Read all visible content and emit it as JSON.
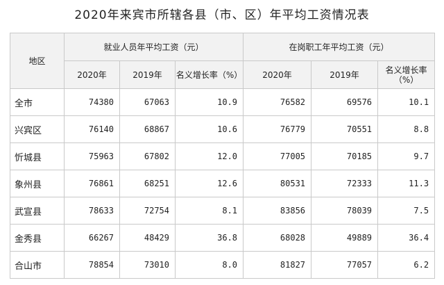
{
  "title": "2020年来宾市所辖各县（市、区）年平均工资情况表",
  "header": {
    "region": "地区",
    "group1": "就业人员年平均工资（元）",
    "group2": "在岗职工年平均工资（元）",
    "col_2020": "2020年",
    "col_2019": "2019年",
    "col_growth": "名义增长率（%）",
    "col_growth2": "名义增长率（%）"
  },
  "rows": [
    {
      "region": "全市",
      "e2020": "74380",
      "e2019": "67063",
      "eg": "10.9",
      "s2020": "76582",
      "s2019": "69576",
      "sg": "10.1"
    },
    {
      "region": "兴宾区",
      "e2020": "76140",
      "e2019": "68867",
      "eg": "10.6",
      "s2020": "76779",
      "s2019": "70551",
      "sg": "8.8"
    },
    {
      "region": "忻城县",
      "e2020": "75963",
      "e2019": "67802",
      "eg": "12.0",
      "s2020": "77005",
      "s2019": "70185",
      "sg": "9.7"
    },
    {
      "region": "象州县",
      "e2020": "76861",
      "e2019": "68251",
      "eg": "12.6",
      "s2020": "80531",
      "s2019": "72333",
      "sg": "11.3"
    },
    {
      "region": "武宣县",
      "e2020": "78633",
      "e2019": "72754",
      "eg": "8.1",
      "s2020": "83856",
      "s2019": "78039",
      "sg": "7.5"
    },
    {
      "region": "金秀县",
      "e2020": "66267",
      "e2019": "48429",
      "eg": "36.8",
      "s2020": "68028",
      "s2019": "49889",
      "sg": "36.4"
    },
    {
      "region": "合山市",
      "e2020": "78854",
      "e2019": "73010",
      "eg": "8.0",
      "s2020": "81827",
      "s2019": "77057",
      "sg": "6.2"
    }
  ]
}
